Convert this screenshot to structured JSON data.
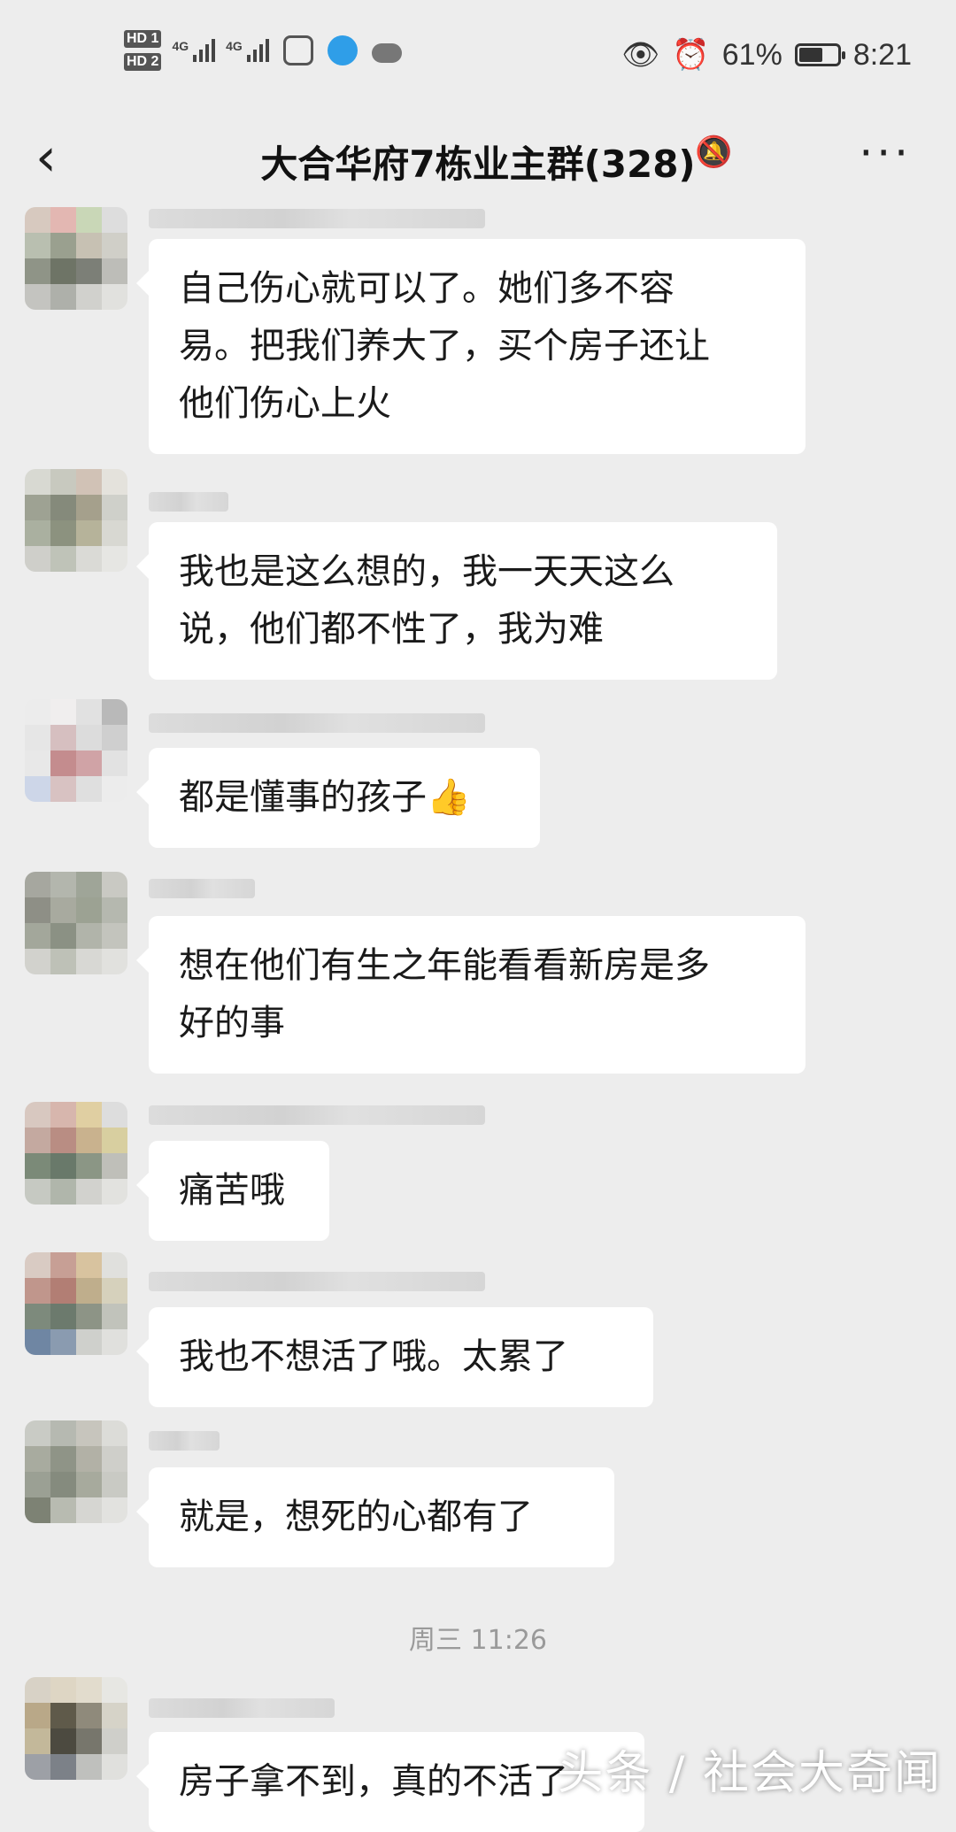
{
  "status_bar": {
    "hd1": "HD 1",
    "hd2": "HD 2",
    "net1": "4G",
    "net2": "4G",
    "battery_percent": "61%",
    "battery_level": 0.61,
    "time": "8:21",
    "icons": [
      "eye-icon",
      "alarm-icon",
      "leaf-icon"
    ]
  },
  "nav": {
    "back_icon": "‹",
    "title": "大合华府7栋业主群(328)",
    "mute_icon": "bell-off-icon",
    "more_icon": "···"
  },
  "messages": [
    {
      "text": "自己伤心就可以了。她们多不容\n易。把我们养大了，买个房子还让\n他们伤心上火"
    },
    {
      "text": "我也是这么想的，我一天天这么\n说，他们都不性了，我为难"
    },
    {
      "text": "都是懂事的孩子👍"
    },
    {
      "text": "想在他们有生之年能看看新房是多\n好的事"
    },
    {
      "text": "痛苦哦"
    },
    {
      "text": "我也不想活了哦。太累了"
    },
    {
      "text": "就是，想死的心都有了"
    },
    {
      "text": "房子拿不到，真的不活了"
    }
  ],
  "time_separator": "周三 11:26",
  "watermark": "头条 / 社会大奇闻",
  "colors": {
    "background": "#ededed",
    "bubble": "#ffffff",
    "separator_text": "#9a9a9a"
  }
}
